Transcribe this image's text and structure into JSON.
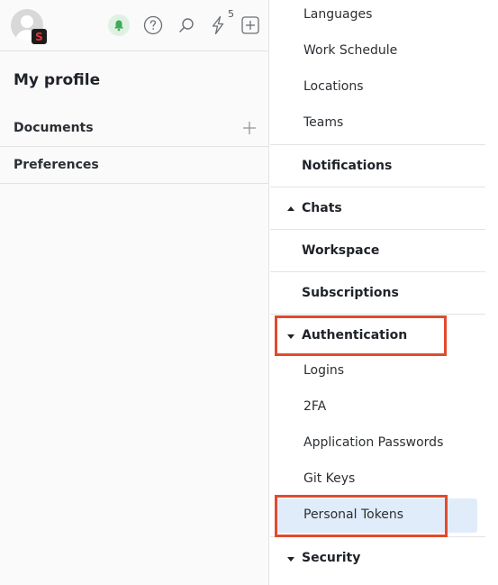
{
  "topbar": {
    "avatar_badge": "S",
    "notification_count": "5",
    "icons": [
      "bell-icon",
      "help-icon",
      "search-icon",
      "lightning-icon",
      "add-icon"
    ]
  },
  "left": {
    "title": "My profile",
    "rows": [
      {
        "label": "Documents"
      },
      {
        "label": "Preferences"
      }
    ]
  },
  "menu": {
    "top_items": [
      "Languages",
      "Work Schedule",
      "Locations",
      "Teams"
    ],
    "notifications": "Notifications",
    "chats": "Chats",
    "workspace": "Workspace",
    "subscriptions": "Subscriptions",
    "authentication": "Authentication",
    "auth_items": [
      "Logins",
      "2FA",
      "Application Passwords",
      "Git Keys",
      "Personal Tokens"
    ],
    "security": "Security"
  },
  "colors": {
    "highlight": "#e14b2d",
    "selected": "#e1ecfb",
    "bell_bg": "#dff1e3",
    "bell": "#3dab5a"
  }
}
